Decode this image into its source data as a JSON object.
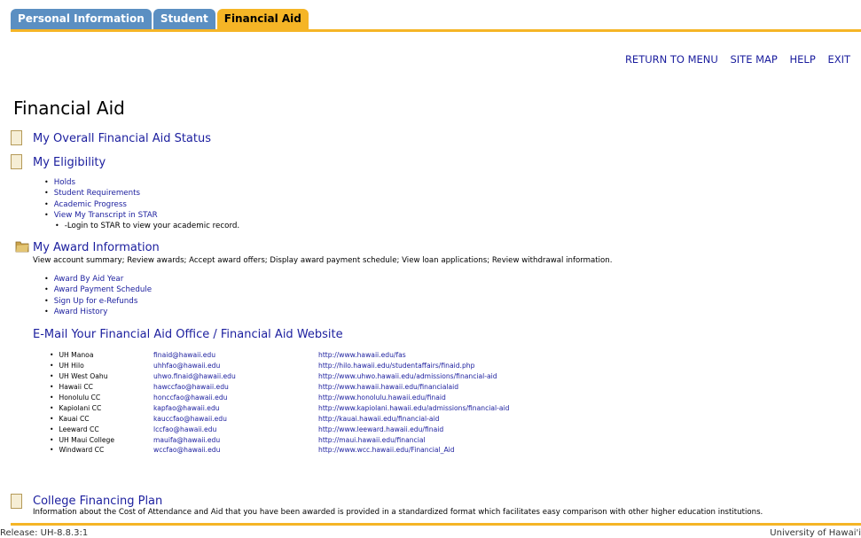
{
  "tabs": [
    {
      "label": "Personal Information"
    },
    {
      "label": "Student"
    },
    {
      "label": "Financial Aid"
    }
  ],
  "toplinks": {
    "return": "RETURN TO MENU",
    "sitemap": "SITE MAP",
    "help": "HELP",
    "exit": "EXIT"
  },
  "page_title": "Financial Aid",
  "sections": {
    "status": {
      "label": "My Overall Financial Aid Status"
    },
    "eligibility": {
      "label": "My Eligibility",
      "items": [
        "Holds",
        "Student Requirements",
        "Academic Progress",
        "View My Transcript in STAR"
      ],
      "note": "-Login to STAR to view your academic record."
    },
    "award": {
      "label": "My Award Information",
      "desc": "View account summary; Review awards; Accept award offers; Display award payment schedule; View loan applications; Review withdrawal information.",
      "items": [
        "Award By Aid Year",
        "Award Payment Schedule",
        "Sign Up for e-Refunds",
        "Award History"
      ]
    },
    "email": {
      "label": "E-Mail Your Financial Aid Office / Financial Aid Website",
      "rows": [
        {
          "campus": "UH Manoa",
          "email": "finaid@hawaii.edu",
          "url": "http://www.hawaii.edu/fas"
        },
        {
          "campus": "UH Hilo",
          "email": "uhhfao@hawaii.edu",
          "url": "http://hilo.hawaii.edu/studentaffairs/finaid.php"
        },
        {
          "campus": "UH West Oahu",
          "email": "uhwo.finaid@hawaii.edu",
          "url": "http://www.uhwo.hawaii.edu/admissions/financial-aid"
        },
        {
          "campus": "Hawaii CC",
          "email": "hawccfao@hawaii.edu",
          "url": "http://www.hawaii.hawaii.edu/financialaid"
        },
        {
          "campus": "Honolulu CC",
          "email": "honccfao@hawaii.edu",
          "url": "http://www.honolulu.hawaii.edu/finaid"
        },
        {
          "campus": "Kapiolani CC",
          "email": "kapfao@hawaii.edu",
          "url": "http://www.kapiolani.hawaii.edu/admissions/financial-aid"
        },
        {
          "campus": "Kauai CC",
          "email": "kauccfao@hawaii.edu",
          "url": "http://kauai.hawaii.edu/financial-aid"
        },
        {
          "campus": "Leeward CC",
          "email": "lccfao@hawaii.edu",
          "url": "http://www.leeward.hawaii.edu/finaid"
        },
        {
          "campus": "UH Maui College",
          "email": "mauifa@hawaii.edu",
          "url": "http://maui.hawaii.edu/financial"
        },
        {
          "campus": "Windward CC",
          "email": "wccfao@hawaii.edu",
          "url": "http://www.wcc.hawaii.edu/Financial_Aid"
        }
      ]
    },
    "plan": {
      "label": "College Financing Plan",
      "desc": "Information about the Cost of Attendance and Aid that you have been awarded is provided in a standardized format which facilitates easy comparison with other higher education institutions."
    }
  },
  "footer": {
    "release": "Release: UH-8.8.3:1",
    "university": "University of Hawai'i"
  },
  "colors": {
    "accent": "#f5b526",
    "tab": "#5b8fc2",
    "link": "#1b1e9e"
  }
}
